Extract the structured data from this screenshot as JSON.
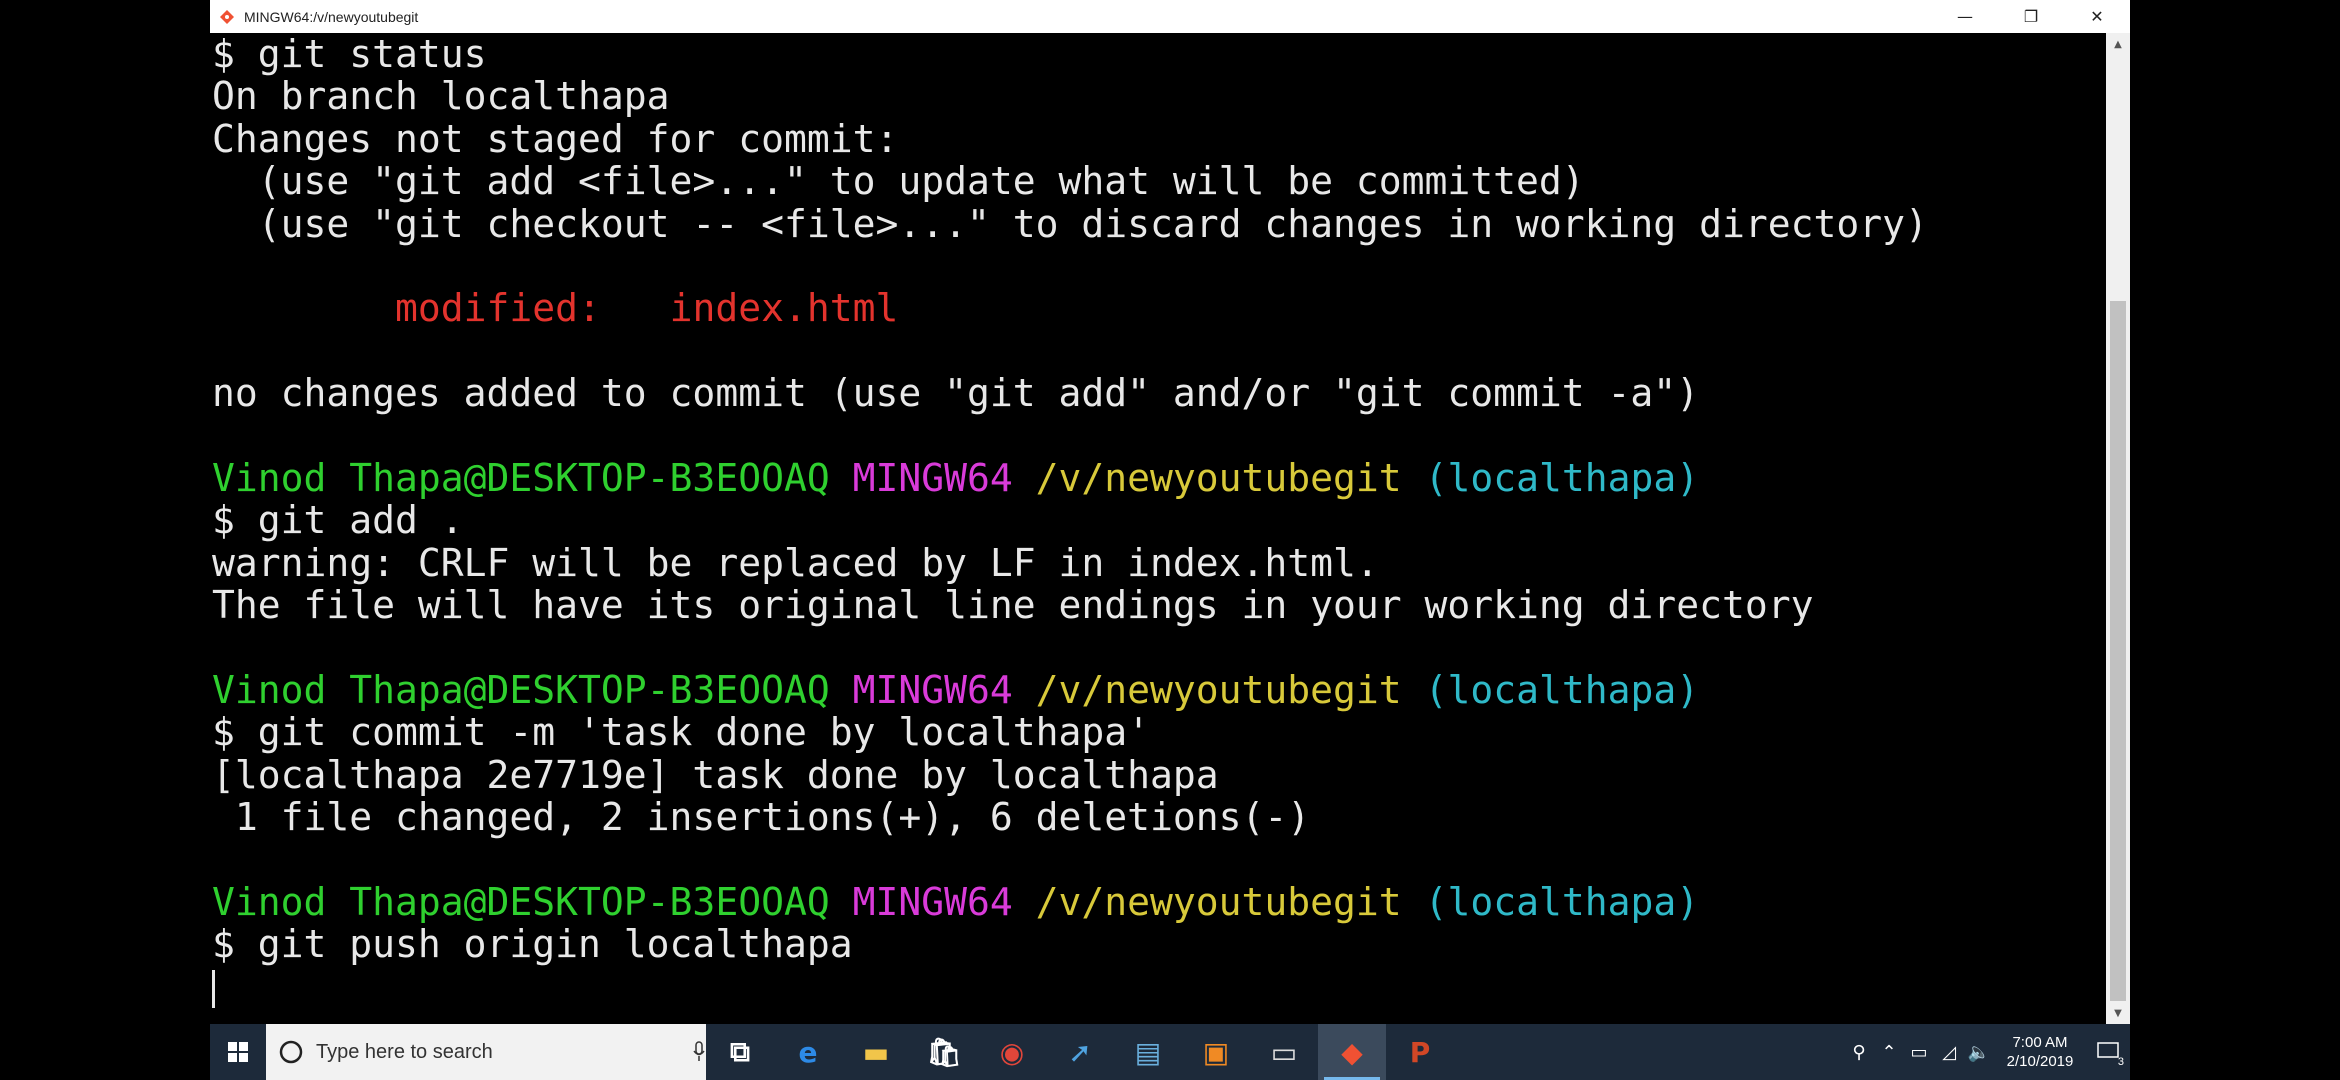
{
  "window": {
    "title": "MINGW64:/v/newyoutubegit",
    "controls": {
      "minimize": "—",
      "maximize": "❐",
      "close": "✕"
    }
  },
  "terminal": {
    "lines": [
      {
        "segments": [
          {
            "text": "$ git status",
            "color": "default"
          }
        ]
      },
      {
        "segments": [
          {
            "text": "On branch localthapa",
            "color": "default"
          }
        ]
      },
      {
        "segments": [
          {
            "text": "Changes not staged for commit:",
            "color": "default"
          }
        ]
      },
      {
        "segments": [
          {
            "text": "  (use \"git add <file>...\" to update what will be committed)",
            "color": "default"
          }
        ]
      },
      {
        "segments": [
          {
            "text": "  (use \"git checkout -- <file>...\" to discard changes in working directory)",
            "color": "default"
          }
        ]
      },
      {
        "segments": [
          {
            "text": "",
            "color": "default"
          }
        ]
      },
      {
        "segments": [
          {
            "text": "        ",
            "color": "default"
          },
          {
            "text": "modified:   index.html",
            "color": "red"
          }
        ]
      },
      {
        "segments": [
          {
            "text": "",
            "color": "default"
          }
        ]
      },
      {
        "segments": [
          {
            "text": "no changes added to commit (use \"git add\" and/or \"git commit -a\")",
            "color": "default"
          }
        ]
      },
      {
        "segments": [
          {
            "text": "",
            "color": "default"
          }
        ]
      },
      {
        "segments": [
          {
            "text": "Vinod Thapa@DESKTOP-B3EOOAQ ",
            "color": "green"
          },
          {
            "text": "MINGW64 ",
            "color": "magenta"
          },
          {
            "text": "/v/newyoutubegit ",
            "color": "yellow"
          },
          {
            "text": "(localthapa)",
            "color": "cyan"
          }
        ]
      },
      {
        "segments": [
          {
            "text": "$ git add .",
            "color": "default"
          }
        ]
      },
      {
        "segments": [
          {
            "text": "warning: CRLF will be replaced by LF in index.html.",
            "color": "default"
          }
        ]
      },
      {
        "segments": [
          {
            "text": "The file will have its original line endings in your working directory",
            "color": "default"
          }
        ]
      },
      {
        "segments": [
          {
            "text": "",
            "color": "default"
          }
        ]
      },
      {
        "segments": [
          {
            "text": "Vinod Thapa@DESKTOP-B3EOOAQ ",
            "color": "green"
          },
          {
            "text": "MINGW64 ",
            "color": "magenta"
          },
          {
            "text": "/v/newyoutubegit ",
            "color": "yellow"
          },
          {
            "text": "(localthapa)",
            "color": "cyan"
          }
        ]
      },
      {
        "segments": [
          {
            "text": "$ git commit -m 'task done by localthapa'",
            "color": "default"
          }
        ]
      },
      {
        "segments": [
          {
            "text": "[localthapa 2e7719e] task done by localthapa",
            "color": "default"
          }
        ]
      },
      {
        "segments": [
          {
            "text": " 1 file changed, 2 insertions(+), 6 deletions(-)",
            "color": "default"
          }
        ]
      },
      {
        "segments": [
          {
            "text": "",
            "color": "default"
          }
        ]
      },
      {
        "segments": [
          {
            "text": "Vinod Thapa@DESKTOP-B3EOOAQ ",
            "color": "green"
          },
          {
            "text": "MINGW64 ",
            "color": "magenta"
          },
          {
            "text": "/v/newyoutubegit ",
            "color": "yellow"
          },
          {
            "text": "(localthapa)",
            "color": "cyan"
          }
        ]
      },
      {
        "segments": [
          {
            "text": "$ git push origin localthapa",
            "color": "default"
          }
        ]
      },
      {
        "segments": [
          {
            "text": "",
            "color": "default"
          }
        ],
        "cursor": true
      }
    ]
  },
  "taskbar": {
    "search_placeholder": "Type here to search",
    "apps": [
      {
        "name": "task-view-icon",
        "glyph": "⧉",
        "color": "#ffffff"
      },
      {
        "name": "edge-icon",
        "glyph": "e",
        "color": "#2d8ae6"
      },
      {
        "name": "file-explorer-icon",
        "glyph": "▬",
        "color": "#f1c54a"
      },
      {
        "name": "store-icon",
        "glyph": "🛍",
        "color": "#ffffff"
      },
      {
        "name": "chrome-icon",
        "glyph": "◉",
        "color": "#e2463a"
      },
      {
        "name": "app-icon",
        "glyph": "➚",
        "color": "#4fa3e0"
      },
      {
        "name": "document-icon",
        "glyph": "▤",
        "color": "#6ab0de"
      },
      {
        "name": "paint-icon",
        "glyph": "▣",
        "color": "#f08a24"
      },
      {
        "name": "terminal-icon",
        "glyph": "▭",
        "color": "#dddddd"
      },
      {
        "name": "git-icon",
        "glyph": "◆",
        "color": "#f05133",
        "active": true
      },
      {
        "name": "powerpoint-icon",
        "glyph": "P",
        "color": "#d24726"
      }
    ],
    "clock": {
      "time": "7:00 AM",
      "date": "2/10/2019"
    },
    "notification_count": "3"
  }
}
